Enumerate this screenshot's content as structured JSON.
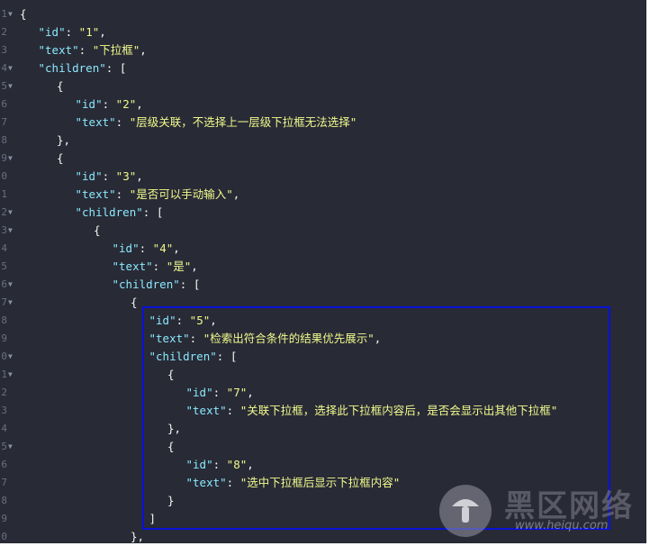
{
  "lines": [
    {
      "n": "1",
      "fold": true,
      "indent": 0,
      "parts": [
        {
          "c": "br",
          "t": "{"
        }
      ]
    },
    {
      "n": "2",
      "fold": false,
      "indent": 1,
      "parts": [
        {
          "c": "key",
          "t": "\"id\""
        },
        {
          "c": "pn",
          "t": ": "
        },
        {
          "c": "str",
          "t": "\"1\""
        },
        {
          "c": "pn",
          "t": ","
        }
      ]
    },
    {
      "n": "3",
      "fold": false,
      "indent": 1,
      "parts": [
        {
          "c": "key",
          "t": "\"text\""
        },
        {
          "c": "pn",
          "t": ": "
        },
        {
          "c": "str",
          "t": "\"下拉框\""
        },
        {
          "c": "pn",
          "t": ","
        }
      ]
    },
    {
      "n": "4",
      "fold": true,
      "indent": 1,
      "parts": [
        {
          "c": "key",
          "t": "\"children\""
        },
        {
          "c": "pn",
          "t": ": ["
        }
      ]
    },
    {
      "n": "5",
      "fold": true,
      "indent": 2,
      "parts": [
        {
          "c": "br",
          "t": "{"
        }
      ]
    },
    {
      "n": "6",
      "fold": false,
      "indent": 3,
      "parts": [
        {
          "c": "key",
          "t": "\"id\""
        },
        {
          "c": "pn",
          "t": ": "
        },
        {
          "c": "str",
          "t": "\"2\""
        },
        {
          "c": "pn",
          "t": ","
        }
      ]
    },
    {
      "n": "7",
      "fold": false,
      "indent": 3,
      "parts": [
        {
          "c": "key",
          "t": "\"text\""
        },
        {
          "c": "pn",
          "t": ": "
        },
        {
          "c": "str",
          "t": "\"层级关联，不选择上一层级下拉框无法选择\""
        }
      ]
    },
    {
      "n": "8",
      "fold": false,
      "indent": 2,
      "parts": [
        {
          "c": "br",
          "t": "},"
        }
      ]
    },
    {
      "n": "9",
      "fold": true,
      "indent": 2,
      "parts": [
        {
          "c": "br",
          "t": "{"
        }
      ]
    },
    {
      "n": "0",
      "fold": false,
      "indent": 3,
      "parts": [
        {
          "c": "key",
          "t": "\"id\""
        },
        {
          "c": "pn",
          "t": ": "
        },
        {
          "c": "str",
          "t": "\"3\""
        },
        {
          "c": "pn",
          "t": ","
        }
      ]
    },
    {
      "n": "1",
      "fold": false,
      "indent": 3,
      "parts": [
        {
          "c": "key",
          "t": "\"text\""
        },
        {
          "c": "pn",
          "t": ": "
        },
        {
          "c": "str",
          "t": "\"是否可以手动输入\""
        },
        {
          "c": "pn",
          "t": ","
        }
      ]
    },
    {
      "n": "2",
      "fold": true,
      "indent": 3,
      "parts": [
        {
          "c": "key",
          "t": "\"children\""
        },
        {
          "c": "pn",
          "t": ": ["
        }
      ]
    },
    {
      "n": "3",
      "fold": true,
      "indent": 4,
      "parts": [
        {
          "c": "br",
          "t": "{"
        }
      ]
    },
    {
      "n": "4",
      "fold": false,
      "indent": 5,
      "parts": [
        {
          "c": "key",
          "t": "\"id\""
        },
        {
          "c": "pn",
          "t": ": "
        },
        {
          "c": "str",
          "t": "\"4\""
        },
        {
          "c": "pn",
          "t": ","
        }
      ]
    },
    {
      "n": "5",
      "fold": false,
      "indent": 5,
      "parts": [
        {
          "c": "key",
          "t": "\"text\""
        },
        {
          "c": "pn",
          "t": ": "
        },
        {
          "c": "str",
          "t": "\"是\""
        },
        {
          "c": "pn",
          "t": ","
        }
      ]
    },
    {
      "n": "6",
      "fold": true,
      "indent": 5,
      "parts": [
        {
          "c": "key",
          "t": "\"children\""
        },
        {
          "c": "pn",
          "t": ": ["
        }
      ]
    },
    {
      "n": "7",
      "fold": true,
      "indent": 6,
      "parts": [
        {
          "c": "br",
          "t": "{"
        }
      ]
    },
    {
      "n": "8",
      "fold": false,
      "indent": 7,
      "parts": [
        {
          "c": "key",
          "t": "\"id\""
        },
        {
          "c": "pn",
          "t": ": "
        },
        {
          "c": "str",
          "t": "\"5\""
        },
        {
          "c": "pn",
          "t": ","
        }
      ]
    },
    {
      "n": "9",
      "fold": false,
      "indent": 7,
      "parts": [
        {
          "c": "key",
          "t": "\"text\""
        },
        {
          "c": "pn",
          "t": ": "
        },
        {
          "c": "str",
          "t": "\"检索出符合条件的结果优先展示\""
        },
        {
          "c": "pn",
          "t": ","
        }
      ]
    },
    {
      "n": "0",
      "fold": true,
      "indent": 7,
      "parts": [
        {
          "c": "key",
          "t": "\"children\""
        },
        {
          "c": "pn",
          "t": ": ["
        }
      ]
    },
    {
      "n": "1",
      "fold": true,
      "indent": 8,
      "parts": [
        {
          "c": "br",
          "t": "{"
        }
      ]
    },
    {
      "n": "2",
      "fold": false,
      "indent": 9,
      "parts": [
        {
          "c": "key",
          "t": "\"id\""
        },
        {
          "c": "pn",
          "t": ": "
        },
        {
          "c": "str",
          "t": "\"7\""
        },
        {
          "c": "pn",
          "t": ","
        }
      ]
    },
    {
      "n": "3",
      "fold": false,
      "indent": 9,
      "parts": [
        {
          "c": "key",
          "t": "\"text\""
        },
        {
          "c": "pn",
          "t": ": "
        },
        {
          "c": "str",
          "t": "\"关联下拉框，选择此下拉框内容后，是否会显示出其他下拉框\""
        }
      ]
    },
    {
      "n": "4",
      "fold": false,
      "indent": 8,
      "parts": [
        {
          "c": "br",
          "t": "},"
        }
      ]
    },
    {
      "n": "5",
      "fold": true,
      "indent": 8,
      "parts": [
        {
          "c": "br",
          "t": "{"
        }
      ]
    },
    {
      "n": "6",
      "fold": false,
      "indent": 9,
      "parts": [
        {
          "c": "key",
          "t": "\"id\""
        },
        {
          "c": "pn",
          "t": ": "
        },
        {
          "c": "str",
          "t": "\"8\""
        },
        {
          "c": "pn",
          "t": ","
        }
      ]
    },
    {
      "n": "7",
      "fold": false,
      "indent": 9,
      "parts": [
        {
          "c": "key",
          "t": "\"text\""
        },
        {
          "c": "pn",
          "t": ": "
        },
        {
          "c": "str",
          "t": "\"选中下拉框后显示下拉框内容\""
        }
      ]
    },
    {
      "n": "8",
      "fold": false,
      "indent": 8,
      "parts": [
        {
          "c": "br",
          "t": "}"
        }
      ]
    },
    {
      "n": "9",
      "fold": false,
      "indent": 7,
      "parts": [
        {
          "c": "br",
          "t": "]"
        }
      ]
    },
    {
      "n": "0",
      "fold": false,
      "indent": 6,
      "parts": [
        {
          "c": "br",
          "t": "},"
        }
      ]
    }
  ],
  "watermark": {
    "title": "黑区网络",
    "url": "www.heiqu.com"
  },
  "colors": {
    "background": "#282a36",
    "key": "#8be9fd",
    "string": "#f1fa8c",
    "highlight_box": "#0a12d8"
  }
}
